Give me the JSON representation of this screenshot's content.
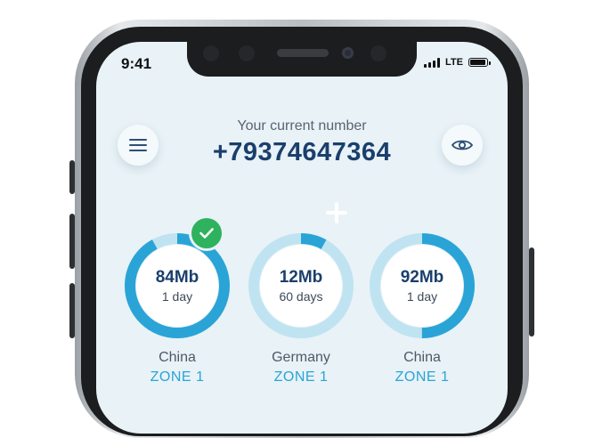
{
  "status_bar": {
    "time": "9:41",
    "network": "LTE"
  },
  "header": {
    "caption": "Your current number",
    "phone_number": "+79374647364"
  },
  "icons": {
    "menu": "hamburger-menu-icon",
    "visibility": "eye-icon",
    "add": "plus-icon",
    "selected": "checkmark-icon"
  },
  "colors": {
    "accent": "#2aa4d6",
    "ring_track": "#bfe3f1",
    "number_text": "#1b3f6c",
    "check": "#2eb25d",
    "screen_bg": "#e8f2f7"
  },
  "packages": [
    {
      "amount": "84Mb",
      "period": "1 day",
      "country": "China",
      "zone": "ZONE 1",
      "remaining_fraction": 0.92,
      "selected": true
    },
    {
      "amount": "12Mb",
      "period": "60 days",
      "country": "Germany",
      "zone": "ZONE 1",
      "remaining_fraction": 0.08,
      "selected": false
    },
    {
      "amount": "92Mb",
      "period": "1 day",
      "country": "China",
      "zone": "ZONE 1",
      "remaining_fraction": 0.5,
      "selected": false
    }
  ]
}
